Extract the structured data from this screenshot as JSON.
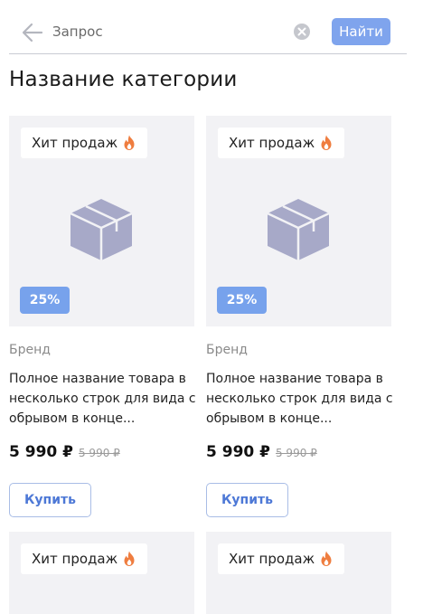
{
  "search": {
    "placeholder": "Запрос",
    "value": "",
    "button_label": "Найти"
  },
  "page_title": "Название категории",
  "colors": {
    "accent": "#7fa4ed",
    "discount": "#77a2ec",
    "fire": "#ef7d3f",
    "box": "#a7a9c8"
  },
  "products": [
    {
      "badge": "Хит продаж",
      "badge_icon": "fire-icon",
      "image_icon": "box-icon",
      "discount": "25%",
      "brand": "Бренд",
      "name": "Полное название товара в несколько строк для вида с обрывом в конце...",
      "price": "5 990 ₽",
      "old_price": "5 990 ₽",
      "buy_label": "Купить"
    },
    {
      "badge": "Хит продаж",
      "badge_icon": "fire-icon",
      "image_icon": "box-icon",
      "discount": "25%",
      "brand": "Бренд",
      "name": "Полное название товара в несколько строк для вида с обрывом в конце...",
      "price": "5 990 ₽",
      "old_price": "5 990 ₽",
      "buy_label": "Купить"
    },
    {
      "badge": "Хит продаж",
      "badge_icon": "fire-icon"
    },
    {
      "badge": "Хит продаж",
      "badge_icon": "fire-icon"
    }
  ]
}
